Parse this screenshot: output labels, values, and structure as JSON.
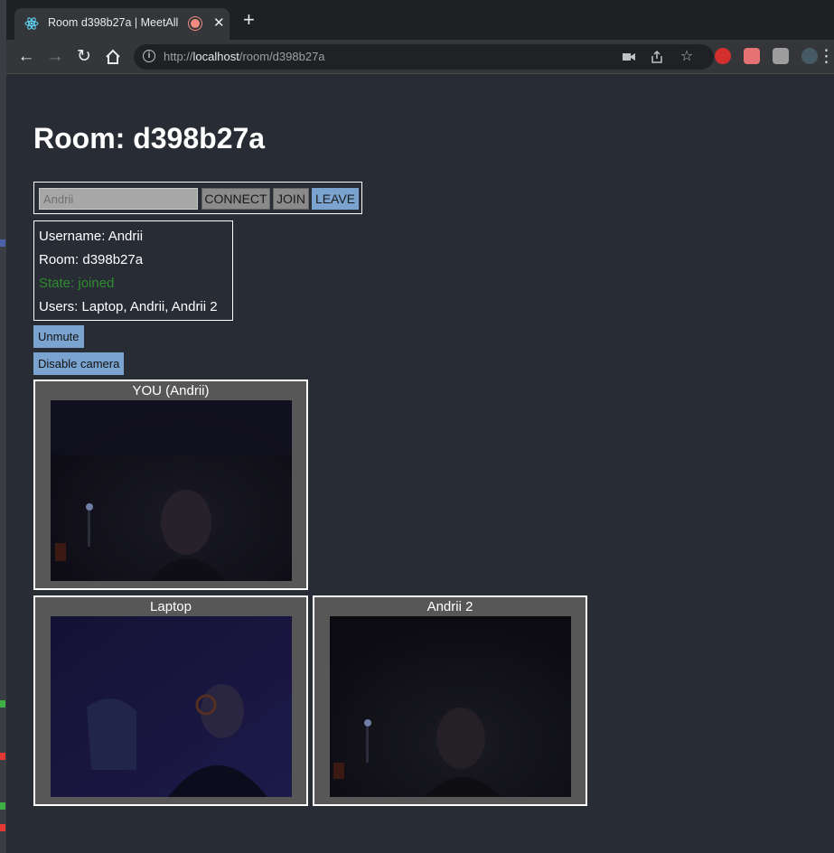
{
  "browser": {
    "tab_title": "Room d398b27a | MeetAll",
    "url_scheme": "http://",
    "url_host": "localhost",
    "url_path": "/room/d398b27a"
  },
  "page": {
    "heading": "Room: d398b27a",
    "username_input_placeholder": "Andrii",
    "connect_label": "CONNECT",
    "join_label": "JOIN",
    "leave_label": "LEAVE",
    "info": {
      "username": "Username: Andrii",
      "room": "Room: d398b27a",
      "state": "State: joined",
      "users": "Users: Laptop, Andrii, Andrii 2"
    },
    "unmute_label": "Unmute",
    "camera_label": "Disable camera",
    "videos": [
      {
        "label": "YOU (Andrii)"
      },
      {
        "label": "Laptop"
      },
      {
        "label": "Andrii 2"
      }
    ]
  },
  "colors": {
    "page_bg": "#282c34",
    "accent_button": "#7aa4cf",
    "state_text": "#2e8b2e"
  }
}
